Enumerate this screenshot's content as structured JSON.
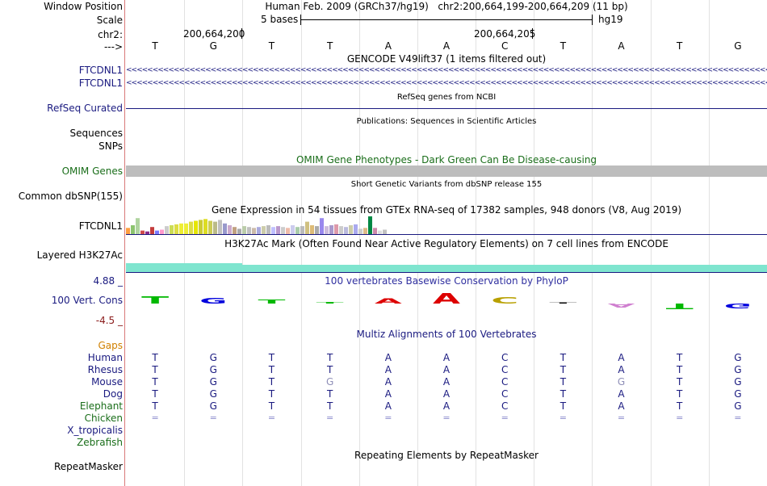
{
  "header": {
    "window_position_label": "Window Position",
    "assembly": "Human Feb. 2009 (GRCh37/hg19)",
    "range": "chr2:200,664,199-200,664,209 (11 bp)",
    "scale_label": "Scale",
    "scale_text": "5 bases",
    "scale_db": "hg19",
    "chr_label": "chr2:",
    "pos1": "200,664,200",
    "pos2": "200,664,205",
    "strand_label": "--->"
  },
  "sequence": [
    "T",
    "G",
    "T",
    "T",
    "A",
    "A",
    "C",
    "T",
    "A",
    "T",
    "G"
  ],
  "tracks": {
    "gencode_title": "GENCODE V49lift37 (1 items filtered out)",
    "gene1": "FTCDNL1",
    "gene2": "FTCDNL1",
    "refseq_title": "RefSeq genes from NCBI",
    "refseq_label": "RefSeq Curated",
    "pubs_title": "Publications: Sequences in Scientific Articles",
    "sequences_label": "Sequences",
    "snps_label": "SNPs",
    "omim_title": "OMIM Gene Phenotypes - Dark Green Can Be Disease-causing",
    "omim_label": "OMIM Genes",
    "dbsnp_title": "Short Genetic Variants from dbSNP release 155",
    "dbsnp_label": "Common dbSNP(155)",
    "gtex_title": "Gene Expression in 54 tissues from GTEx RNA-seq of 17382 samples, 948 donors (V8, Aug 2019)",
    "gtex_label": "FTCDNL1",
    "h3k_title": "H3K27Ac Mark (Often Found Near Active Regulatory Elements) on 7 cell lines from ENCODE",
    "h3k_label": "Layered H3K27Ac",
    "cons_max": "4.88 _",
    "cons_label": "100 Vert. Cons",
    "cons_min": "-4.5 _",
    "phylop_title": "100 vertebrates Basewise Conservation by PhyloP",
    "multiz_title": "Multiz Alignments of 100 Vertebrates",
    "gaps_label": "Gaps",
    "repeat_title": "Repeating Elements by RepeatMasker",
    "repeat_label": "RepeatMasker"
  },
  "species": [
    {
      "name": "Human",
      "seq": [
        "T",
        "G",
        "T",
        "T",
        "A",
        "A",
        "C",
        "T",
        "A",
        "T",
        "G"
      ]
    },
    {
      "name": "Rhesus",
      "seq": [
        "T",
        "G",
        "T",
        "T",
        "A",
        "A",
        "C",
        "T",
        "A",
        "T",
        "G"
      ]
    },
    {
      "name": "Mouse",
      "seq": [
        "T",
        "G",
        "T",
        "G",
        "A",
        "A",
        "C",
        "T",
        "G",
        "T",
        "G"
      ]
    },
    {
      "name": "Dog",
      "seq": [
        "T",
        "G",
        "T",
        "T",
        "A",
        "A",
        "C",
        "T",
        "A",
        "T",
        "G"
      ]
    },
    {
      "name": "Elephant",
      "seq": [
        "T",
        "G",
        "T",
        "T",
        "A",
        "A",
        "C",
        "T",
        "A",
        "T",
        "G"
      ]
    },
    {
      "name": "Chicken",
      "seq": [
        "=",
        "=",
        "=",
        "=",
        "=",
        "=",
        "=",
        "=",
        "=",
        "=",
        "="
      ]
    },
    {
      "name": "X_tropicalis",
      "seq": []
    },
    {
      "name": "Zebrafish",
      "seq": []
    }
  ],
  "gtex_values": [
    0.35,
    0.5,
    0.9,
    0.2,
    0.15,
    0.4,
    0.2,
    0.25,
    0.45,
    0.5,
    0.55,
    0.6,
    0.6,
    0.7,
    0.75,
    0.8,
    0.85,
    0.75,
    0.7,
    0.8,
    0.6,
    0.5,
    0.4,
    0.3,
    0.45,
    0.4,
    0.35,
    0.4,
    0.45,
    0.5,
    0.4,
    0.45,
    0.4,
    0.35,
    0.5,
    0.4,
    0.45,
    0.7,
    0.5,
    0.45,
    0.9,
    0.45,
    0.5,
    0.55,
    0.45,
    0.4,
    0.5,
    0.55,
    0.3,
    0.35,
    1.0,
    0.35,
    0.2,
    0.25
  ],
  "gtex_colors": [
    "#ff9e40",
    "#8cc46e",
    "#b0d4a0",
    "#d04a4a",
    "#8a2a8a",
    "#c43c3c",
    "#7a7aff",
    "#ff99cc",
    "#cccccc",
    "#ccdd55",
    "#dddd44",
    "#eeee33",
    "#eeee33",
    "#dddd44",
    "#e6e600",
    "#cccc33",
    "#dddd22",
    "#cccc55",
    "#bbbb88",
    "#c0c0c0",
    "#9999cc",
    "#ccaacc",
    "#c0a080",
    "#aaaaaa",
    "#bbccaa",
    "#c0c0c0",
    "#ccbbaa",
    "#aaaadd",
    "#ccccaa",
    "#bbbbbb",
    "#c0c0ff",
    "#bb99cc",
    "#cccccc",
    "#eebbaa",
    "#ccccee",
    "#aaccaa",
    "#bbbbbb",
    "#d0c080",
    "#ddbb77",
    "#aaaaaa",
    "#9988ee",
    "#ccbbdd",
    "#aa99cc",
    "#dd99aa",
    "#cccccc",
    "#bbbbdd",
    "#ccccaa",
    "#aaaaee",
    "#cccccc",
    "#ddbb88",
    "#008844",
    "#cc88aa",
    "#dddddd",
    "#c0c0c0"
  ],
  "phylop": [
    {
      "h": 0.55,
      "color": "#00b800"
    },
    {
      "h": 0.45,
      "color": "#0000dd"
    },
    {
      "h": 0.3,
      "color": "#00b800"
    },
    {
      "h": 0.1,
      "color": "#00b800"
    },
    {
      "h": 0.4,
      "color": "#dd0000"
    },
    {
      "h": 0.8,
      "color": "#dd0000"
    },
    {
      "h": 0.5,
      "color": "#b8a000"
    },
    {
      "h": 0.0,
      "color": "#000000"
    },
    {
      "h": -0.3,
      "color": "#d080d0"
    },
    {
      "h": -0.45,
      "color": "#00b800"
    },
    {
      "h": -0.35,
      "color": "#0000dd"
    }
  ]
}
